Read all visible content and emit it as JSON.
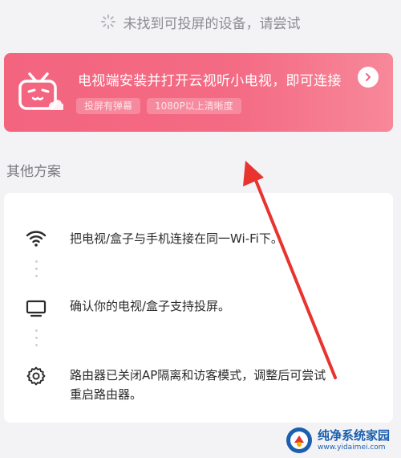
{
  "status": {
    "text": "未找到可投屏的设备，请尝试"
  },
  "banner": {
    "title": "电视端安装并打开云视听小电视，即可连接",
    "tags": [
      "投屏有弹幕",
      "1080P以上清晰度"
    ],
    "accent": "#f3647f"
  },
  "section": {
    "title": "其他方案"
  },
  "steps": [
    {
      "icon": "wifi-icon",
      "text": "把电视/盒子与手机连接在同一Wi-Fi下。"
    },
    {
      "icon": "monitor-icon",
      "text": "确认你的电视/盒子支持投屏。"
    },
    {
      "icon": "settings-icon",
      "text": "路由器已关闭AP隔离和访客模式，调整后可尝试重启路由器。"
    }
  ],
  "watermark": {
    "name": "纯净系统家园",
    "url": "www.yidaimei.com"
  },
  "annotation": {
    "color": "#e8332f"
  }
}
